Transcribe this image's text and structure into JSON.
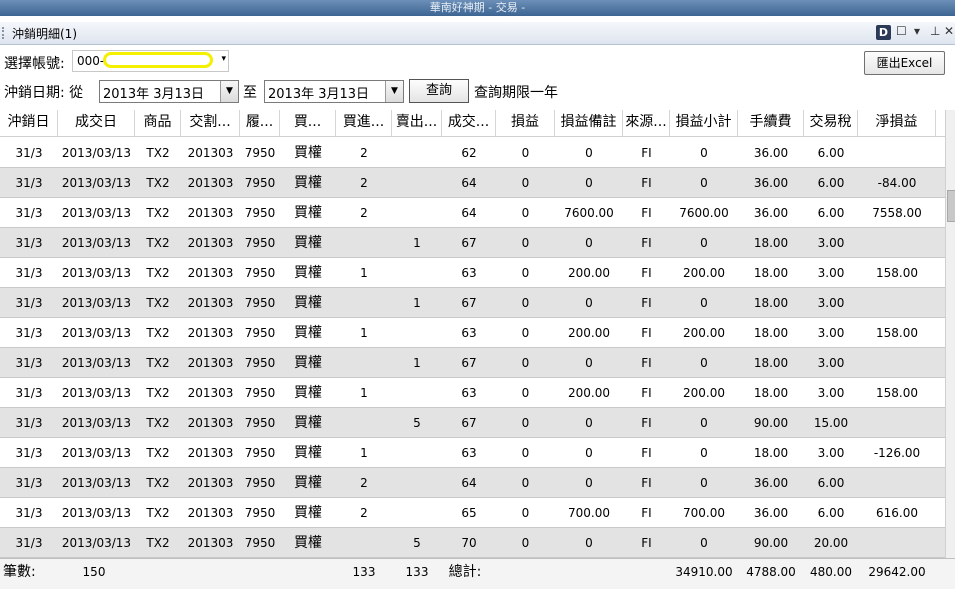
{
  "window": {
    "title": "華南好神期 - 交易 -"
  },
  "panel": {
    "title": "沖銷明細(1)",
    "d_label": "D",
    "buttons": [
      "☐",
      "▾",
      "⊥",
      "✕"
    ]
  },
  "account": {
    "label": "選擇帳號:",
    "value": "000-",
    "arrow": "▾"
  },
  "export_label": "匯出Excel",
  "date": {
    "label": "沖銷日期: 從",
    "from": "2013年  3月13日",
    "to_label": "至",
    "to": "2013年  3月13日",
    "drop": "▼",
    "query_label": "查詢",
    "note": "查詢期限一年"
  },
  "columns": [
    "沖銷日",
    "成交日",
    "商品",
    "交割...",
    "履...",
    "買...",
    "買進...",
    "賣出...",
    "成交...",
    "損益",
    "損益備註",
    "來源...",
    "損益小計",
    "手續費",
    "交易稅",
    "淨損益"
  ],
  "rows": [
    [
      "31/3",
      "2013/03/13",
      "TX2",
      "201303",
      "7950",
      "買權",
      "2",
      "",
      "62",
      "0",
      "0",
      "FI",
      "0",
      "36.00",
      "6.00",
      ""
    ],
    [
      "31/3",
      "2013/03/13",
      "TX2",
      "201303",
      "7950",
      "買權",
      "2",
      "",
      "64",
      "0",
      "0",
      "FI",
      "0",
      "36.00",
      "6.00",
      "-84.00"
    ],
    [
      "31/3",
      "2013/03/13",
      "TX2",
      "201303",
      "7950",
      "買權",
      "2",
      "",
      "64",
      "0",
      "7600.00",
      "FI",
      "7600.00",
      "36.00",
      "6.00",
      "7558.00"
    ],
    [
      "31/3",
      "2013/03/13",
      "TX2",
      "201303",
      "7950",
      "買權",
      "",
      "1",
      "67",
      "0",
      "0",
      "FI",
      "0",
      "18.00",
      "3.00",
      ""
    ],
    [
      "31/3",
      "2013/03/13",
      "TX2",
      "201303",
      "7950",
      "買權",
      "1",
      "",
      "63",
      "0",
      "200.00",
      "FI",
      "200.00",
      "18.00",
      "3.00",
      "158.00"
    ],
    [
      "31/3",
      "2013/03/13",
      "TX2",
      "201303",
      "7950",
      "買權",
      "",
      "1",
      "67",
      "0",
      "0",
      "FI",
      "0",
      "18.00",
      "3.00",
      ""
    ],
    [
      "31/3",
      "2013/03/13",
      "TX2",
      "201303",
      "7950",
      "買權",
      "1",
      "",
      "63",
      "0",
      "200.00",
      "FI",
      "200.00",
      "18.00",
      "3.00",
      "158.00"
    ],
    [
      "31/3",
      "2013/03/13",
      "TX2",
      "201303",
      "7950",
      "買權",
      "",
      "1",
      "67",
      "0",
      "0",
      "FI",
      "0",
      "18.00",
      "3.00",
      ""
    ],
    [
      "31/3",
      "2013/03/13",
      "TX2",
      "201303",
      "7950",
      "買權",
      "1",
      "",
      "63",
      "0",
      "200.00",
      "FI",
      "200.00",
      "18.00",
      "3.00",
      "158.00"
    ],
    [
      "31/3",
      "2013/03/13",
      "TX2",
      "201303",
      "7950",
      "買權",
      "",
      "5",
      "67",
      "0",
      "0",
      "FI",
      "0",
      "90.00",
      "15.00",
      ""
    ],
    [
      "31/3",
      "2013/03/13",
      "TX2",
      "201303",
      "7950",
      "買權",
      "1",
      "",
      "63",
      "0",
      "0",
      "FI",
      "0",
      "18.00",
      "3.00",
      "-126.00"
    ],
    [
      "31/3",
      "2013/03/13",
      "TX2",
      "201303",
      "7950",
      "買權",
      "2",
      "",
      "64",
      "0",
      "0",
      "FI",
      "0",
      "36.00",
      "6.00",
      ""
    ],
    [
      "31/3",
      "2013/03/13",
      "TX2",
      "201303",
      "7950",
      "買權",
      "2",
      "",
      "65",
      "0",
      "700.00",
      "FI",
      "700.00",
      "36.00",
      "6.00",
      "616.00"
    ],
    [
      "31/3",
      "2013/03/13",
      "TX2",
      "201303",
      "7950",
      "買權",
      "",
      "5",
      "70",
      "0",
      "0",
      "FI",
      "0",
      "90.00",
      "20.00",
      ""
    ]
  ],
  "footer": {
    "count_label": "筆數:",
    "count": "150",
    "buy_total": "133",
    "sell_total": "133",
    "total_label": "總計:",
    "pl_subtotal": "34910.00",
    "fee_total": "4788.00",
    "tax_total": "480.00",
    "net_total": "29642.00"
  }
}
